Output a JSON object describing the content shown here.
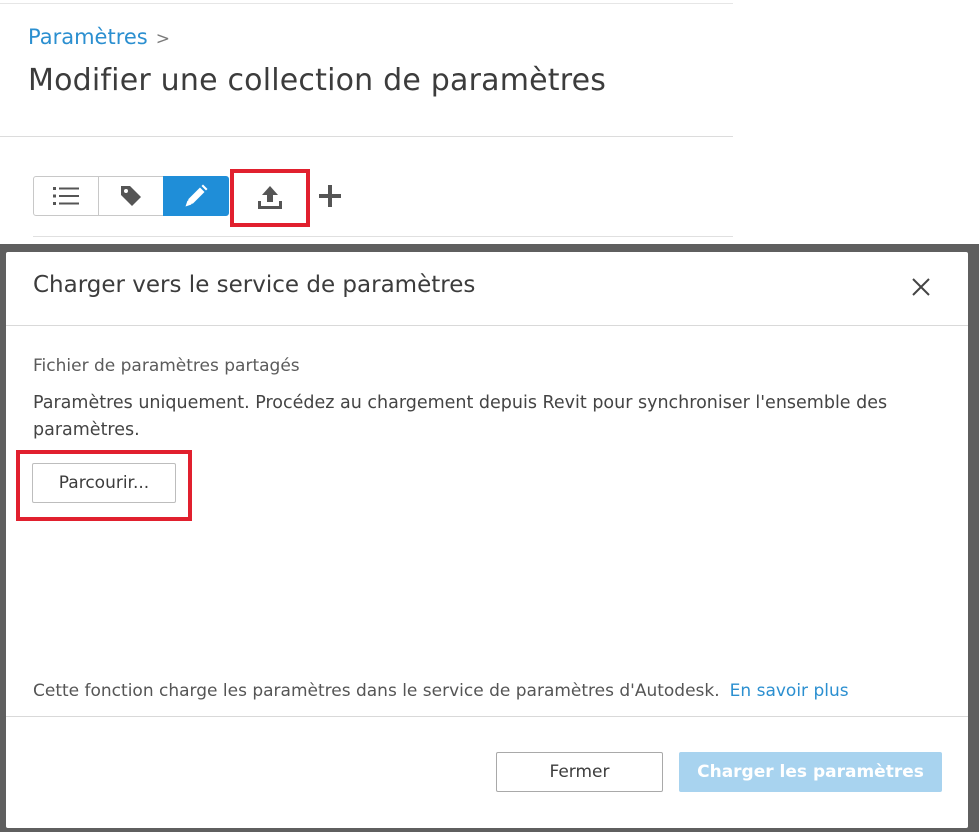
{
  "breadcrumb": {
    "link": "Paramètres",
    "separator": ">"
  },
  "page": {
    "title": "Modifier une collection de paramètres"
  },
  "toolbar": {
    "buttons": [
      {
        "icon": "list-icon"
      },
      {
        "icon": "tag-icon"
      },
      {
        "icon": "pencil-icon",
        "active": true
      },
      {
        "icon": "upload-icon",
        "highlighted": true
      },
      {
        "icon": "plus-icon"
      }
    ]
  },
  "dialog": {
    "title": "Charger vers le service de paramètres",
    "close_icon": "close-icon",
    "section_label": "Fichier de paramètres partagés",
    "description": "Paramètres uniquement. Procédez au chargement depuis Revit pour synchroniser l'ensemble des paramètres.",
    "browse_label": "Parcourir...",
    "footnote": "Cette fonction charge les paramètres dans le service de paramètres d'Autodesk.",
    "learn_more": "En savoir plus",
    "close_label": "Fermer",
    "upload_label": "Charger les paramètres"
  },
  "colors": {
    "accent": "#1f8ed8",
    "link": "#2b8fd0",
    "highlight": "#e1202e",
    "disabled_primary": "#a8d3ef",
    "overlay": "#5f5f5f"
  }
}
